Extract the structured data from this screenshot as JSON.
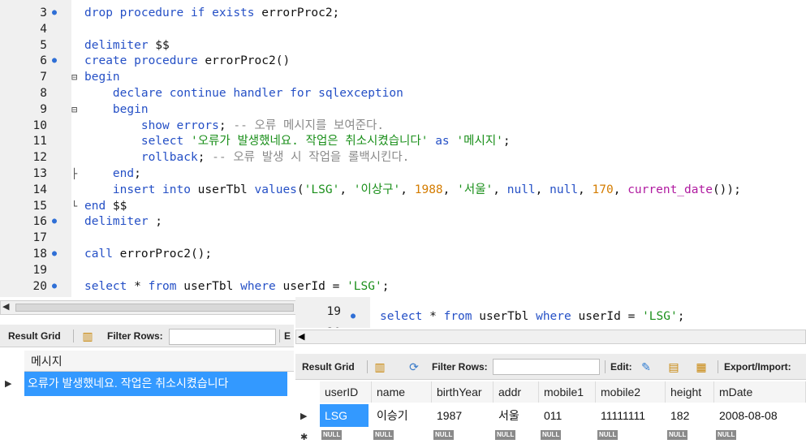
{
  "editor": {
    "lines": [
      {
        "num": "3",
        "dot": true,
        "html": "<span class='kw'>drop procedure if exists</span> errorProc2;"
      },
      {
        "num": "4",
        "dot": false,
        "html": ""
      },
      {
        "num": "5",
        "dot": false,
        "html": "<span class='kw'>delimiter</span> $$"
      },
      {
        "num": "6",
        "dot": true,
        "html": "<span class='kw'>create procedure</span> errorProc2()"
      },
      {
        "num": "7",
        "dot": false,
        "fold": "⊟",
        "html": "<span class='kw'>begin</span>"
      },
      {
        "num": "8",
        "dot": false,
        "html": "    <span class='kw'>declare continue handler for sqlexception</span>"
      },
      {
        "num": "9",
        "dot": false,
        "fold": "⊟",
        "html": "    <span class='kw'>begin</span>"
      },
      {
        "num": "10",
        "dot": false,
        "html": "        <span class='kw'>show errors</span>; <span class='cm'>-- 오류 메시지를 보여준다.</span>"
      },
      {
        "num": "11",
        "dot": false,
        "html": "        <span class='kw'>select</span> <span class='str'>'오류가 발생했네요. 작업은 취소시켰습니다'</span> <span class='kw'>as</span> <span class='str'>'메시지'</span>;"
      },
      {
        "num": "12",
        "dot": false,
        "html": "        <span class='kw'>rollback</span>; <span class='cm'>-- 오류 발생 시 작업을 롤백시킨다.</span>"
      },
      {
        "num": "13",
        "dot": false,
        "fold": "├",
        "html": "    <span class='kw'>end</span>;"
      },
      {
        "num": "14",
        "dot": false,
        "html": "    <span class='kw'>insert into</span> userTbl <span class='kw'>values</span>(<span class='str'>'LSG'</span>, <span class='str'>'이상구'</span>, <span class='num'>1988</span>, <span class='str'>'서울'</span>, <span class='kw'>null</span>, <span class='kw'>null</span>, <span class='num'>170</span>, <span class='fn'>current_date</span>());"
      },
      {
        "num": "15",
        "dot": false,
        "fold": "└",
        "html": "<span class='kw'>end</span> $$"
      },
      {
        "num": "16",
        "dot": true,
        "html": "<span class='kw'>delimiter</span> ;"
      },
      {
        "num": "17",
        "dot": false,
        "html": ""
      },
      {
        "num": "18",
        "dot": true,
        "html": "<span class='kw'>call</span> errorProc2();"
      },
      {
        "num": "19",
        "dot": false,
        "html": ""
      },
      {
        "num": "20",
        "dot": true,
        "html": "<span class='kw'>select</span> * <span class='kw'>from</span> userTbl <span class='kw'>where</span> userId = <span class='str'>'LSG'</span>;"
      }
    ]
  },
  "left_panel": {
    "result_grid_label": "Result Grid",
    "filter_label": "Filter Rows:",
    "trailing_label": "E",
    "column_header": "메시지",
    "row_value": "오류가 발생했네요. 작업은 취소시켰습니다"
  },
  "right_panel": {
    "partial_line_num": "19",
    "line_num": "20",
    "line_html": "<span class='kw'>select</span> * <span class='kw'>from</span> userTbl <span class='kw'>where</span> userId = <span class='str'>'LSG'</span>;",
    "result_grid_label": "Result Grid",
    "filter_label": "Filter Rows:",
    "edit_label": "Edit:",
    "export_label": "Export/Import:",
    "columns": [
      "userID",
      "name",
      "birthYear",
      "addr",
      "mobile1",
      "mobile2",
      "height",
      "mDate"
    ],
    "row": [
      "LSG",
      "이승기",
      "1987",
      "서울",
      "011",
      "11111111",
      "182",
      "2008-08-08"
    ],
    "null_label": "NULL"
  },
  "colors": {
    "keyword": "#2550c6",
    "string": "#1a8f1a",
    "number": "#d47c00",
    "selection": "#3399ff"
  }
}
